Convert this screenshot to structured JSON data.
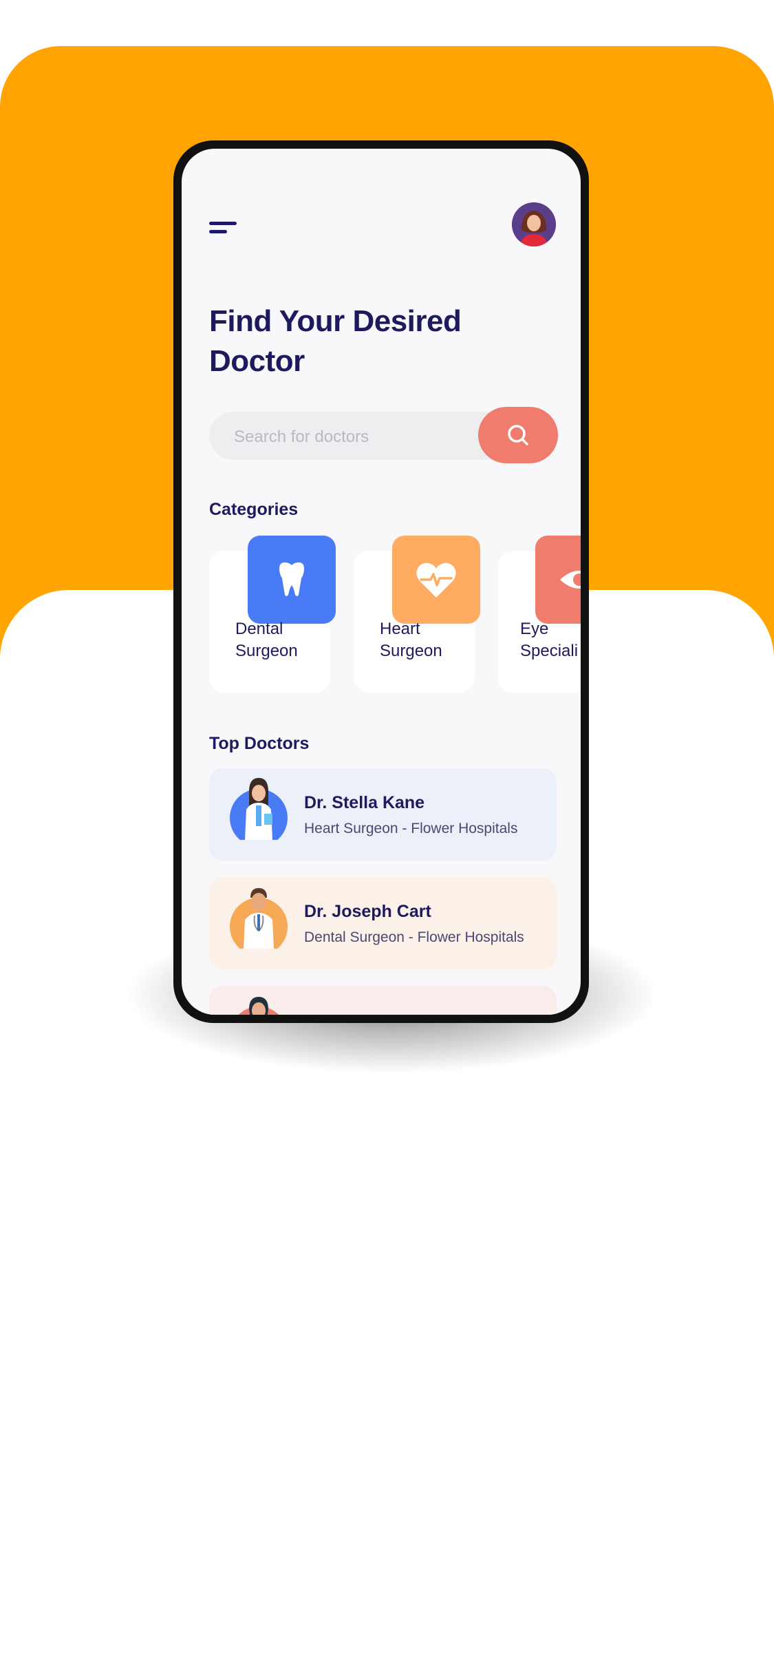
{
  "header": {
    "menu_icon": "menu-icon",
    "avatar_icon": "user-avatar"
  },
  "title": "Find Your Desired Doctor",
  "search": {
    "placeholder": "Search for doctors",
    "button_icon": "search-icon"
  },
  "categories": {
    "heading": "Categories",
    "items": [
      {
        "line1": "Dental",
        "line2": "Surgeon",
        "icon": "tooth-icon",
        "color": "#4A7BF7"
      },
      {
        "line1": "Heart",
        "line2": "Surgeon",
        "icon": "heart-pulse-icon",
        "color": "#FFAB61"
      },
      {
        "line1": "Eye",
        "line2": "Speciali",
        "icon": "eye-icon",
        "color": "#F07C6E"
      }
    ]
  },
  "top_doctors": {
    "heading": "Top Doctors",
    "items": [
      {
        "name": "Dr. Stella Kane",
        "specialty": "Heart Surgeon - Flower Hospitals",
        "card_color": "#EBF0F9",
        "avatar_color": "#4A7BF7"
      },
      {
        "name": "Dr. Joseph Cart",
        "specialty": "Dental Surgeon - Flower Hospitals",
        "card_color": "#FBF1E8",
        "avatar_color": "#F8A955"
      },
      {
        "name": "",
        "specialty": "",
        "card_color": "#F9ECEB",
        "avatar_color": "#F07C6E"
      }
    ]
  },
  "colors": {
    "background_accent": "#FFA401",
    "title": "#1D1A5E",
    "search_button": "#F07C6E"
  }
}
